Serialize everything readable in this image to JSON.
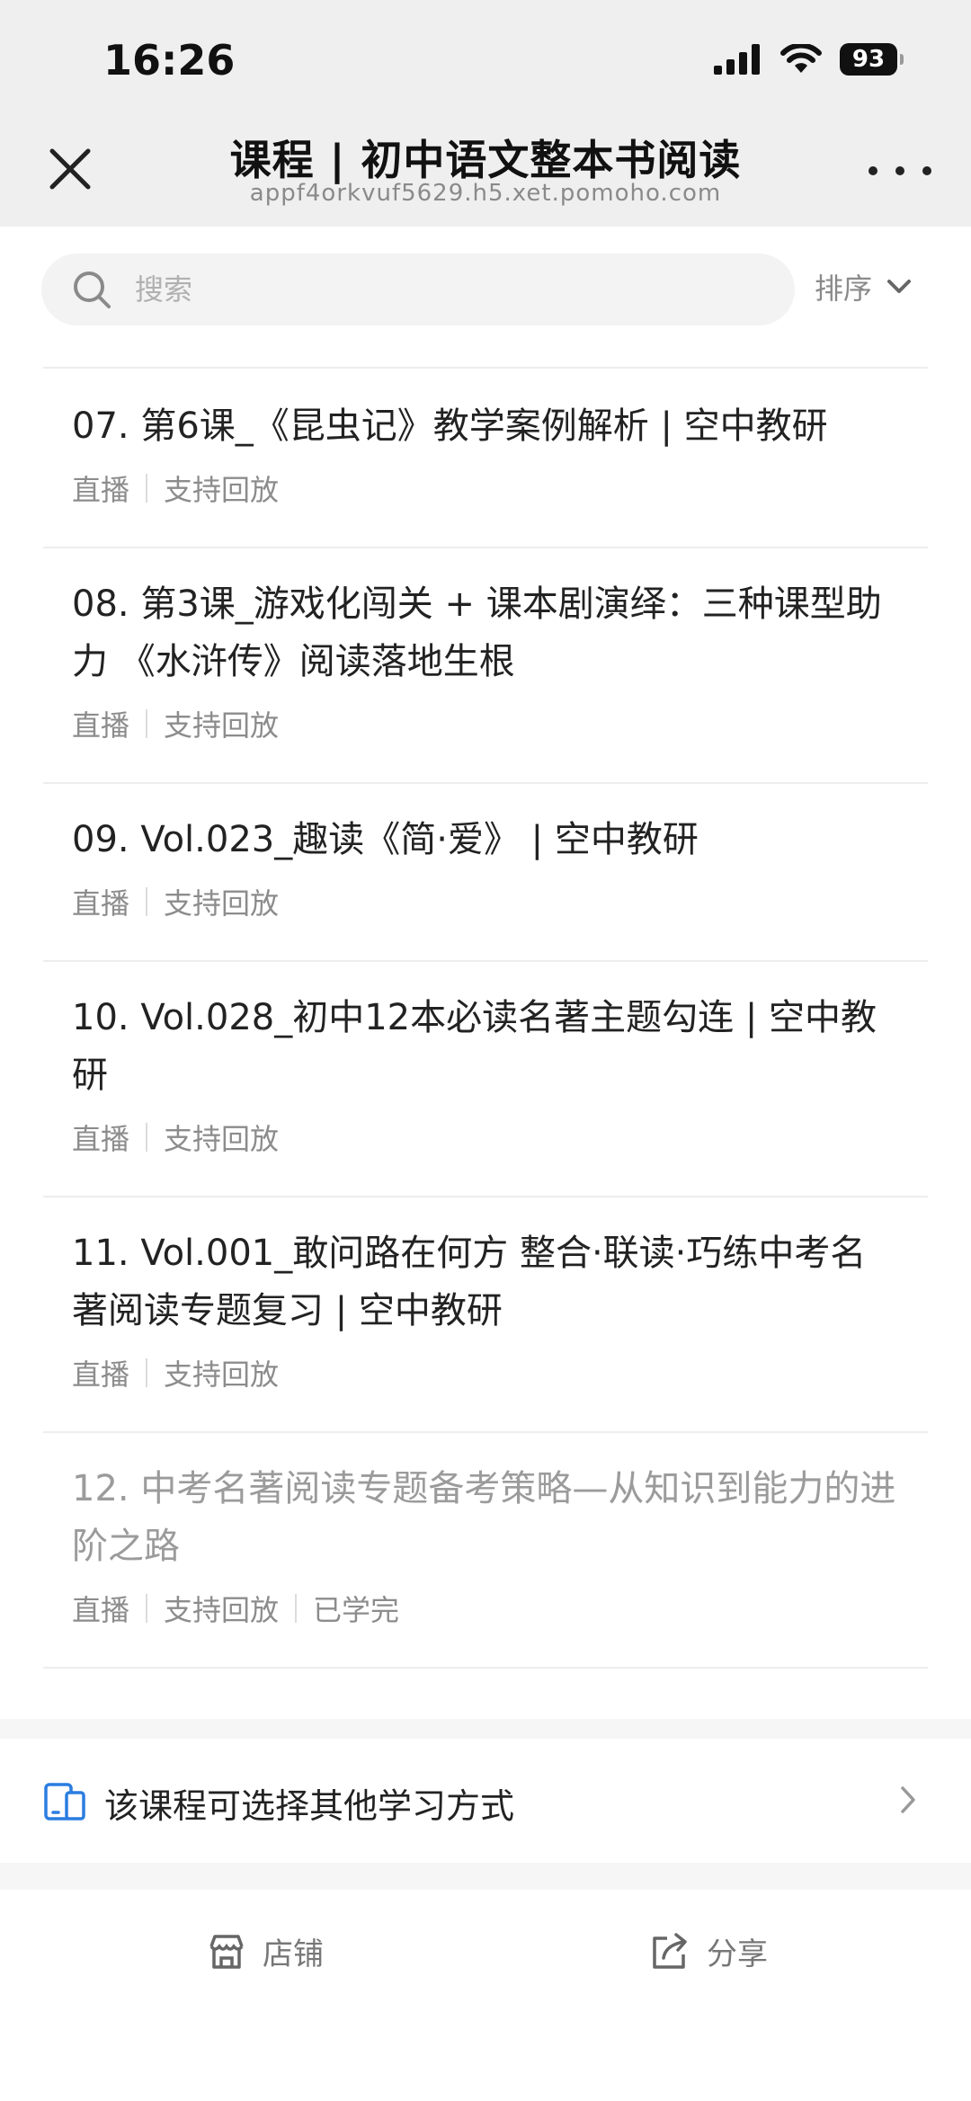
{
  "status": {
    "time": "16:26",
    "battery": "93"
  },
  "nav": {
    "title": "课程 | 初中语文整本书阅读",
    "url": "appf4orkvuf5629.h5.xet.pomoho.com"
  },
  "search": {
    "placeholder": "搜索"
  },
  "sort": {
    "label": "排序"
  },
  "items": [
    {
      "title": "07. 第6课_《昆虫记》教学案例解析 | 空中教研",
      "tags": [
        "直播",
        "支持回放"
      ]
    },
    {
      "title": "08. 第3课_游戏化闯关 + 课本剧演绎：三种课型助力 《水浒传》阅读落地生根",
      "tags": [
        "直播",
        "支持回放"
      ]
    },
    {
      "title": "09. Vol.023_趣读《简·爱》 | 空中教研",
      "tags": [
        "直播",
        "支持回放"
      ]
    },
    {
      "title": "10. Vol.028_初中12本必读名著主题勾连 | 空中教研",
      "tags": [
        "直播",
        "支持回放"
      ]
    },
    {
      "title": "11. Vol.001_敢问路在何方 整合·联读·巧练中考名著阅读专题复习 | 空中教研",
      "tags": [
        "直播",
        "支持回放"
      ]
    },
    {
      "title": "12. 中考名著阅读专题备考策略—从知识到能力的进阶之路",
      "tags": [
        "直播",
        "支持回放",
        "已学完"
      ]
    }
  ],
  "other": {
    "label": "该课程可选择其他学习方式"
  },
  "bottom": {
    "store_label": "店铺",
    "share_label": "分享"
  },
  "colors": {
    "accent": "#2a7de1",
    "background": "#efefef"
  },
  "icons": [
    "close-icon",
    "more-icon",
    "search-icon",
    "chevron-down-icon",
    "phone-tablet-icon",
    "chevron-right-icon",
    "store-icon",
    "share-icon"
  ]
}
